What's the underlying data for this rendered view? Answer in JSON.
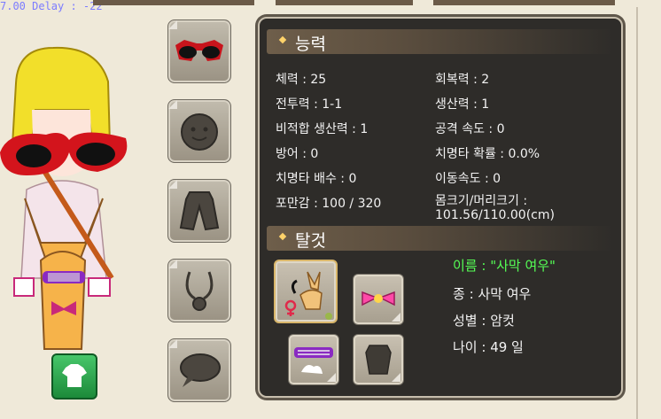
{
  "debug_text": "7.00  Delay : -22",
  "sections": {
    "abilities_title": "능력",
    "mount_title": "탈것"
  },
  "stats": {
    "left": [
      "체력 : 25",
      "전투력 : 1-1",
      "비적합 생산력 : 1",
      "방어 : 0",
      "치명타 배수 : 0",
      "포만감 : 100 / 320"
    ],
    "right": [
      "회복력 : 2",
      "생산력 : 1",
      "공격 속도 : 0",
      "치명타 확률 : 0.0%",
      "이동속도 : 0",
      "몸크기/머리크기 : 101.56/110.00(cm)"
    ]
  },
  "mount": {
    "name": "이름 : \"사막 여우\"",
    "species": "종 : 사막 여우",
    "gender": "성별 : 암컷",
    "age": "나이 : 49 일"
  },
  "equipment_slots": [
    "sunglasses-icon",
    "face-icon",
    "coat-icon",
    "necklace-icon",
    "speech-bubble-icon"
  ],
  "colors": {
    "panel_bg": "#2e2c29",
    "name_green": "#55ff55",
    "slot_bg": "#b2aa9b",
    "wardrobe_green": "#2fa650"
  }
}
